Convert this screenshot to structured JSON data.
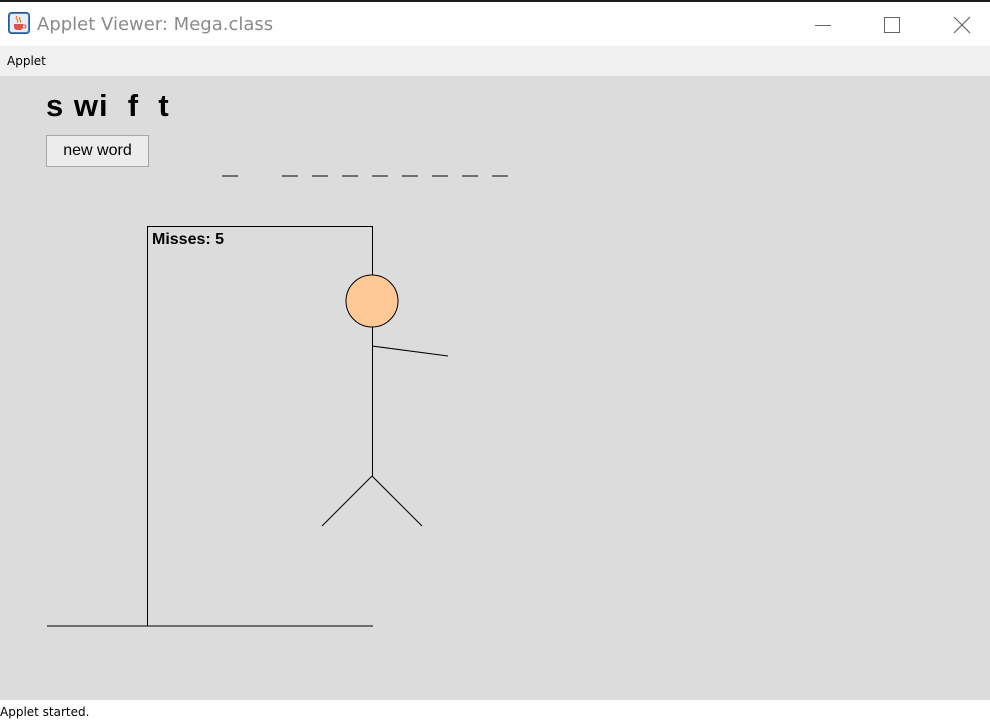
{
  "window": {
    "title": "Applet Viewer: Mega.class",
    "icon": "java-coffee-cup-icon",
    "controls": [
      "minimize-icon",
      "maximize-icon",
      "close-icon"
    ]
  },
  "menubar": {
    "items": [
      {
        "label": "Applet"
      }
    ]
  },
  "game": {
    "guessed_letters": "s wi  f  t",
    "new_word_label": "new word",
    "word_blanks": [
      "_",
      "",
      "_",
      "_",
      "_",
      "_",
      "_",
      "_",
      "_",
      "_"
    ],
    "misses_label": "Misses: 5",
    "misses": 5,
    "colors": {
      "background": "#dcdcdc",
      "head_fill": "#ffc896",
      "line": "#000000"
    }
  },
  "status": {
    "text": "Applet started."
  }
}
